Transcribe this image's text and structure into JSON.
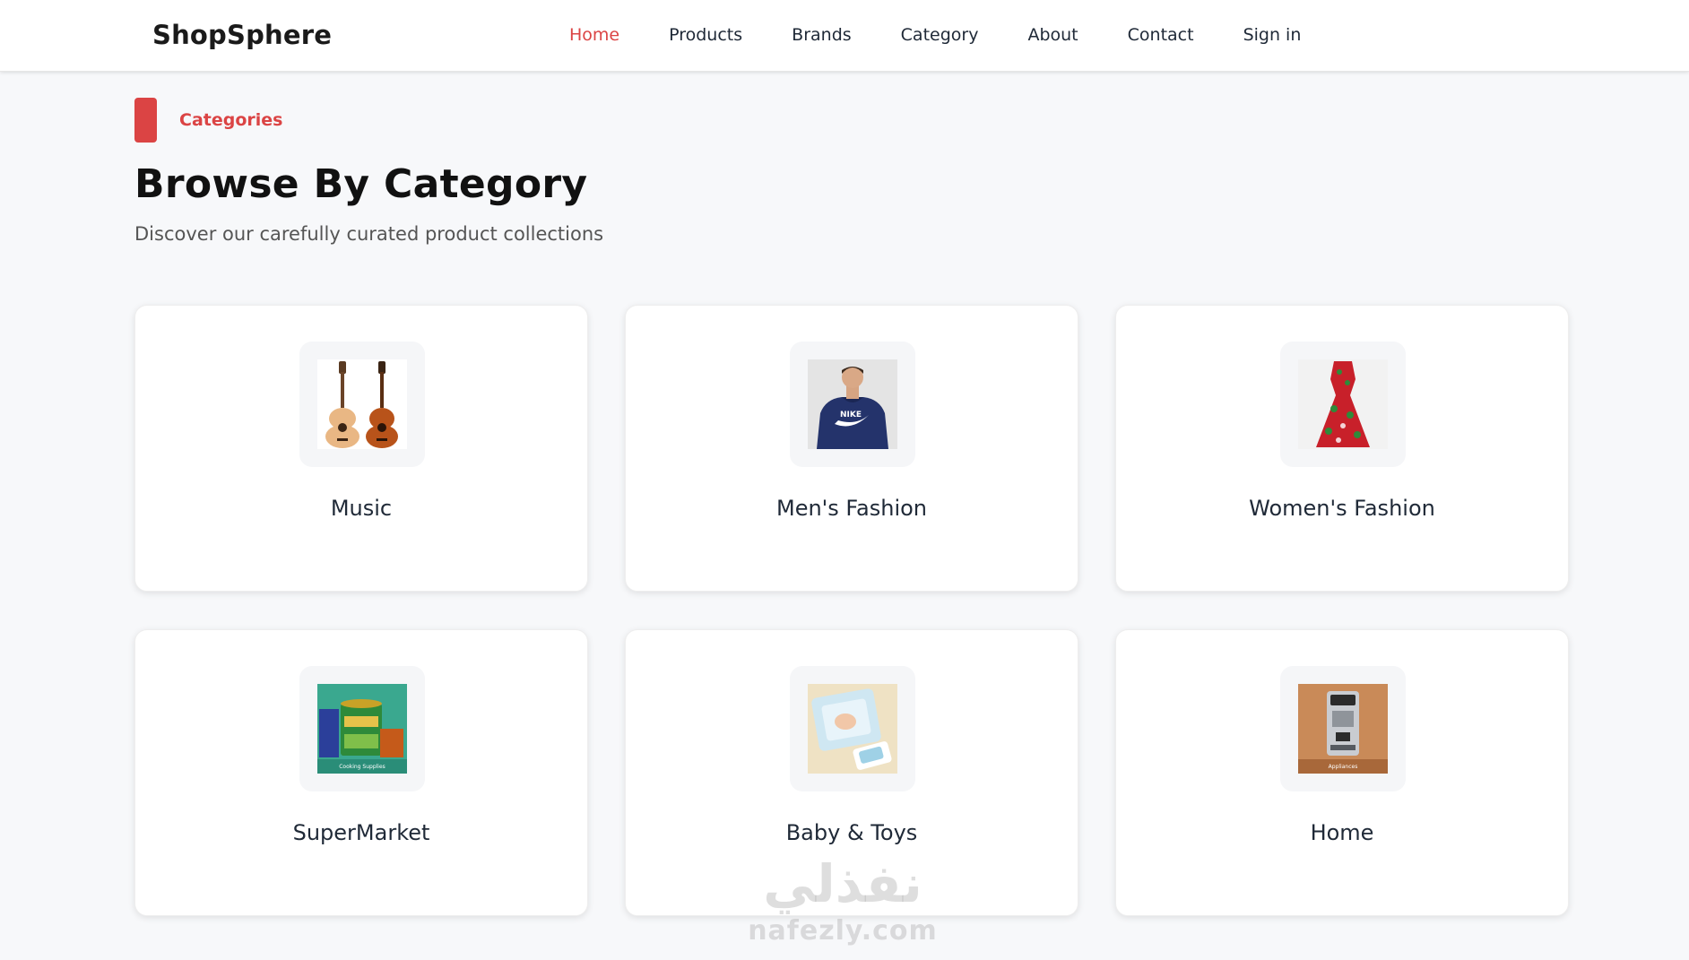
{
  "header": {
    "brand": "ShopSphere",
    "nav": [
      {
        "label": "Home",
        "active": true
      },
      {
        "label": "Products"
      },
      {
        "label": "Brands"
      },
      {
        "label": "Category"
      },
      {
        "label": "About"
      },
      {
        "label": "Contact"
      },
      {
        "label": "Sign in"
      }
    ]
  },
  "section": {
    "tag": "Categories",
    "title": "Browse By Category",
    "subtitle": "Discover our carefully curated product collections"
  },
  "categories": [
    {
      "label": "Music",
      "image": "guitars-image"
    },
    {
      "label": "Men's Fashion",
      "image": "man-hoodie-image"
    },
    {
      "label": "Women's Fashion",
      "image": "floral-dress-image"
    },
    {
      "label": "SuperMarket",
      "image": "cooking-supplies-image",
      "caption": "Cooking Supplies"
    },
    {
      "label": "Baby & Toys",
      "image": "baby-products-image"
    },
    {
      "label": "Home",
      "image": "coffee-machine-image",
      "caption": "Appliances"
    }
  ],
  "watermark": {
    "arabic": "نفذلي",
    "latin": "nafezly.com"
  },
  "colors": {
    "accent": "#db4444",
    "background": "#f7f8fa",
    "card": "#ffffff"
  }
}
